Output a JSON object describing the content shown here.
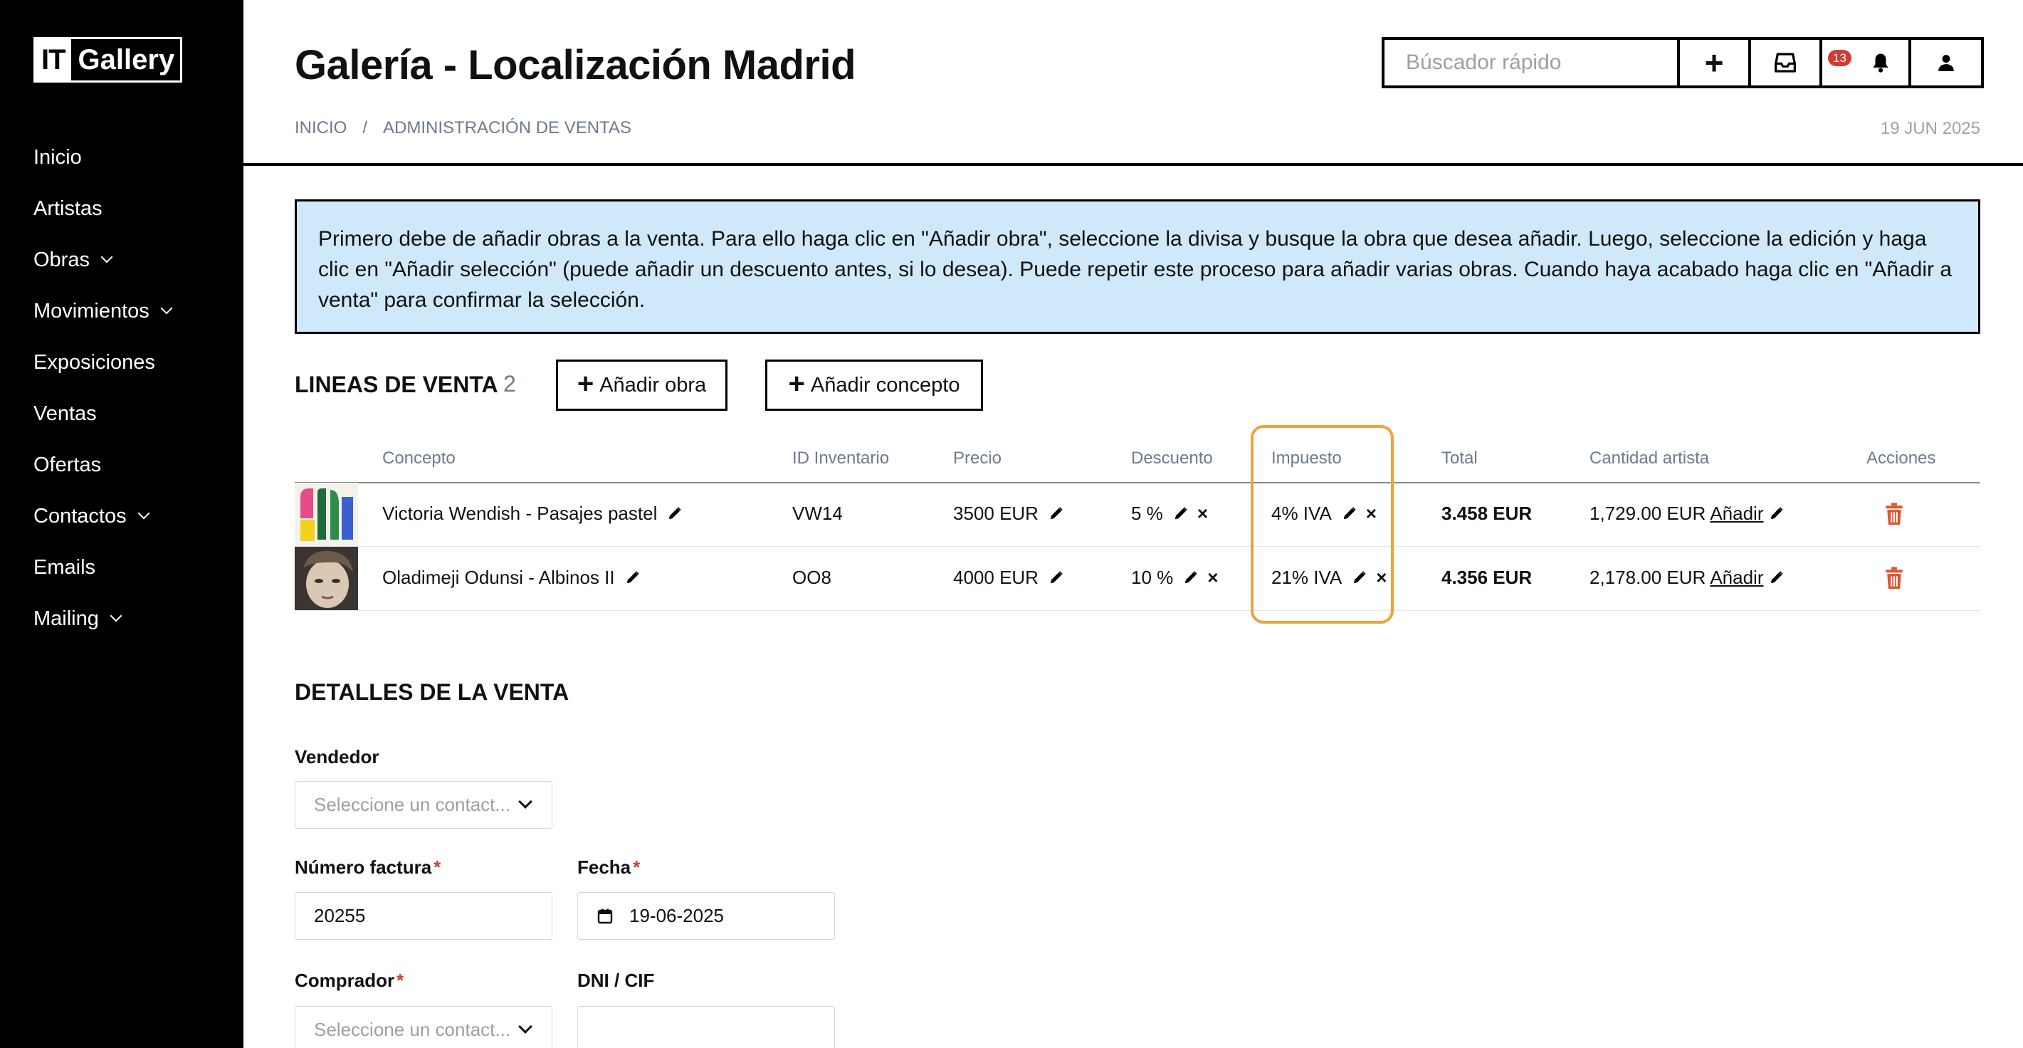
{
  "sidebar": {
    "logo_it": "IT",
    "logo_gallery": "Gallery",
    "items": [
      {
        "label": "Inicio"
      },
      {
        "label": "Artistas"
      },
      {
        "label": "Obras"
      },
      {
        "label": "Movimientos"
      },
      {
        "label": "Exposiciones"
      },
      {
        "label": "Ventas"
      },
      {
        "label": "Ofertas"
      },
      {
        "label": "Contactos"
      },
      {
        "label": "Emails"
      },
      {
        "label": "Mailing"
      }
    ]
  },
  "header": {
    "title": "Galería - Localización Madrid",
    "breadcrumb": [
      "INICIO",
      "/",
      "ADMINISTRACIÓN DE VENTAS"
    ],
    "date": "19 JUN 2025",
    "search_placeholder": "Búscador rápido",
    "notification_count": "13"
  },
  "info": {
    "text": "Primero debe de añadir obras a la venta. Para ello haga clic en \"Añadir obra\", seleccione la divisa y busque la obra que desea añadir. Luego, seleccione la edición y haga clic en \"Añadir selección\" (puede añadir un descuento antes, si lo desea). Puede repetir este proceso para añadir varias obras. Cuando haya acabado haga clic en \"Añadir a venta\" para confirmar la selección."
  },
  "lines": {
    "title": "LINEAS DE VENTA",
    "count": "2",
    "add_obra": "Añadir obra",
    "add_concepto": "Añadir concepto",
    "columns": [
      "Concepto",
      "ID Inventario",
      "Precio",
      "Descuento",
      "Impuesto",
      "Total",
      "Cantidad artista",
      "Acciones"
    ],
    "rows": [
      {
        "concepto": "Victoria Wendish - Pasajes pastel",
        "id": "VW14",
        "precio": "3500 EUR",
        "descuento": "5 %",
        "impuesto": "4% IVA",
        "total": "3.458 EUR",
        "cantidad": "1,729.00 EUR",
        "anadir": "Añadir"
      },
      {
        "concepto": "Oladimeji Odunsi - Albinos II",
        "id": "OO8",
        "precio": "4000 EUR",
        "descuento": "10 %",
        "impuesto": "21% IVA",
        "total": "4.356 EUR",
        "cantidad": "2,178.00 EUR",
        "anadir": "Añadir"
      }
    ]
  },
  "details": {
    "title": "DETALLES DE LA VENTA",
    "vendedor_label": "Vendedor",
    "vendedor_placeholder": "Seleccione un contact...",
    "factura_label": "Número factura",
    "factura_value": "20255",
    "fecha_label": "Fecha",
    "fecha_value": "19-06-2025",
    "comprador_label": "Comprador",
    "comprador_placeholder": "Seleccione un contact...",
    "dni_label": "DNI / CIF",
    "required_mark": "*"
  },
  "colors": {
    "sidebar_bg": "#000000",
    "info_bg": "#cfe9fb",
    "highlight": "#f0a040",
    "danger": "#d63a2f"
  }
}
